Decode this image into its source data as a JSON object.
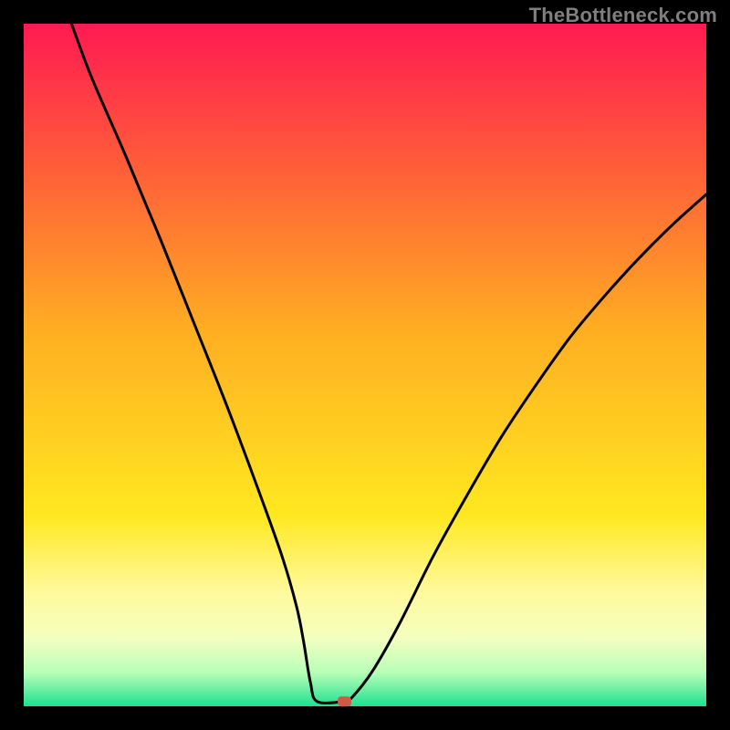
{
  "watermark": "TheBottleneck.com",
  "chart_data": {
    "type": "line",
    "title": "",
    "xlabel": "",
    "ylabel": "",
    "xlim": [
      0,
      100
    ],
    "ylim": [
      0,
      100
    ],
    "curve": {
      "x": [
        7,
        10,
        15,
        20,
        25,
        30,
        35,
        38,
        40,
        41,
        42,
        43,
        47,
        48,
        51,
        55,
        60,
        65,
        70,
        75,
        80,
        85,
        90,
        95,
        100
      ],
      "y": [
        100,
        92,
        80.5,
        68.5,
        56,
        43.4,
        30,
        21.5,
        14.5,
        9.5,
        3.5,
        0.7,
        0.7,
        1.2,
        5,
        12,
        22,
        31,
        39.5,
        47,
        54,
        60,
        65.5,
        70.5,
        75
      ]
    },
    "marker": {
      "x": 47,
      "y": 0.7
    },
    "background": {
      "description": "Vertical gradient from red (top) through orange/yellow to green (bottom) inside a black border",
      "stops": [
        {
          "offset": 0.0,
          "color": "#ff1a52"
        },
        {
          "offset": 0.2,
          "color": "#ff5a3a"
        },
        {
          "offset": 0.45,
          "color": "#ffae22"
        },
        {
          "offset": 0.72,
          "color": "#ffe820"
        },
        {
          "offset": 0.83,
          "color": "#fff99a"
        },
        {
          "offset": 0.9,
          "color": "#f4ffc0"
        },
        {
          "offset": 0.95,
          "color": "#b8ffb8"
        },
        {
          "offset": 1.0,
          "color": "#20e090"
        }
      ]
    },
    "border_px": 26
  }
}
